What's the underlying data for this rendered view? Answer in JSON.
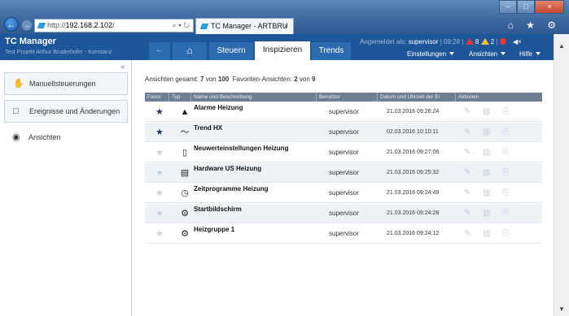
{
  "browser": {
    "url_prefix": "http://",
    "url_host": "192.168.2.102",
    "url_suffix": "/",
    "address_controls": "⌕ ▾ ↻",
    "tab_title": "TC Manager - ARTBRU",
    "tab_close": "×",
    "window_buttons": [
      "−",
      "□",
      "×"
    ],
    "right_icons": "⌂ ★ ⚙"
  },
  "app": {
    "title": "TC Manager",
    "subtitle": "Test Projekt Arthur Bruderhofer - Konstanz",
    "back_label": "←",
    "home_label": "⌂",
    "tabs": [
      {
        "label": "Steuern"
      },
      {
        "label": "Inspizieren"
      },
      {
        "label": "Trends"
      }
    ],
    "active_tab": "Inspizieren",
    "user_prefix": "Angemeldet als: ",
    "user_name": "supervisor",
    "user_sep": " | ",
    "time": "09:28",
    "alarm_red_count": "8",
    "alarm_yellow_count": "2",
    "mute_label": "◀×",
    "menus": [
      {
        "label": "Einstellungen"
      },
      {
        "label": "Ansichten"
      },
      {
        "label": "Hilfe"
      }
    ]
  },
  "sidebar": {
    "collapse_label": "«",
    "items": [
      {
        "label": "Manuellsteuerungen",
        "icon": "hand-icon",
        "glyph": "✋"
      },
      {
        "label": "Ereignisse und Änderungen",
        "icon": "book-icon",
        "glyph": "□"
      },
      {
        "label": "Ansichten",
        "icon": "eye-icon",
        "glyph": "◉"
      }
    ]
  },
  "summary": {
    "total_label": "Ansichten gesamt: ",
    "total_shown": "7",
    "total_of": " von ",
    "total_all": "100",
    "fav_label": "  Favoriten-Ansichten: ",
    "fav_shown": "2",
    "fav_of": " von ",
    "fav_all": "9"
  },
  "table": {
    "headers": [
      "Favor",
      "Typ",
      "Name und Beschreibung",
      "Benutzer",
      "Datum und Uhrzeit der Er",
      "Aktionen"
    ],
    "rows": [
      {
        "name": "Alarme Heizung",
        "user": "supervisor",
        "date": "21.03.2016 09:26:24",
        "favorite": true,
        "type_icon": "alarm-icon",
        "glyph": "▲"
      },
      {
        "name": "Trend HX",
        "user": "supervisor",
        "date": "02.03.2016 10:10:11",
        "favorite": true,
        "type_icon": "trend-icon",
        "glyph": "〜"
      },
      {
        "name": "Neuwerteinstellungen Heizung",
        "user": "supervisor",
        "date": "21.03.2016 09:27:06",
        "favorite": false,
        "type_icon": "book-icon",
        "glyph": "▯"
      },
      {
        "name": "Hardware US Heizung",
        "user": "supervisor",
        "date": "21.03.2016 09:25:32",
        "favorite": false,
        "type_icon": "device-icon",
        "glyph": "▤"
      },
      {
        "name": "Zeitprogramme Heizung",
        "user": "supervisor",
        "date": "21.03.2016 09:24:49",
        "favorite": false,
        "type_icon": "clock-icon",
        "glyph": "◷"
      },
      {
        "name": "Startbildschirm",
        "user": "supervisor",
        "date": "21.03.2016 09:24:28",
        "favorite": false,
        "type_icon": "gear-icon",
        "glyph": "⚙"
      },
      {
        "name": "Heizgruppe 1",
        "user": "supervisor",
        "date": "21.03.2016 09:24:12",
        "favorite": false,
        "type_icon": "gear-icon",
        "glyph": "⚙"
      }
    ],
    "star_glyph": "★",
    "action_glyphs": "✎ ▥ ⎘"
  },
  "colors": {
    "header_blue": "#1e5799",
    "table_header": "#6e7f94",
    "alert_red": "#e53935",
    "alert_yellow": "#fbc02d",
    "star_active": "#1e3a5f",
    "star_inactive": "#c8d0da"
  }
}
